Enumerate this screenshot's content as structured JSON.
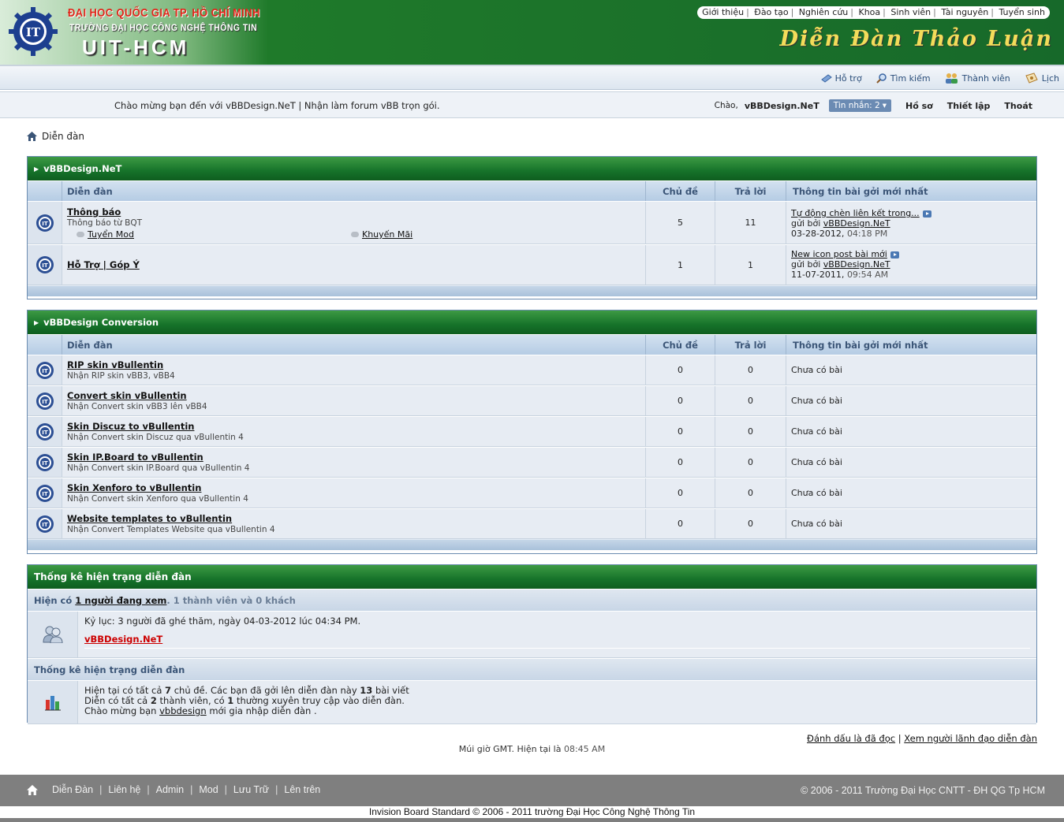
{
  "header": {
    "line1": "ĐẠI HỌC QUỐC GIA TP. HỒ CHÍ MINH",
    "line2": "TRƯỜNG ĐẠI HỌC CÔNG NGHỆ THÔNG TIN",
    "line3": "UIT-HCM",
    "logo_text": "IT",
    "site_title": "Diễn Đàn Thảo Luận",
    "topnav": [
      "Giới thiệu",
      "Đào tạo",
      "Nghiên cứu",
      "Khoa",
      "Sinh viên",
      "Tài nguyên",
      "Tuyển sinh"
    ]
  },
  "navbar": {
    "items": [
      {
        "label": "Hỗ trợ",
        "icon": "help-icon"
      },
      {
        "label": "Tìm kiếm",
        "icon": "search-icon"
      },
      {
        "label": "Thành viên",
        "icon": "members-icon"
      },
      {
        "label": "Lịch",
        "icon": "calendar-icon"
      }
    ]
  },
  "welcome": {
    "message": "Chào mừng bạn đến với vBBDesign.NeT | Nhận làm forum vBB trọn gói.",
    "hello": "Chào,",
    "username": "vBBDesign.NeT",
    "pm_label": "Tin nhắn: 2",
    "links": [
      "Hồ sơ",
      "Thiết lập",
      "Thoát"
    ]
  },
  "breadcrumb": {
    "label": "Diễn đàn"
  },
  "columns": {
    "forum": "Diễn đàn",
    "threads": "Chủ đề",
    "posts": "Trả lời",
    "last": "Thông tin bài gởi mới nhất"
  },
  "categories": [
    {
      "title": "vBBDesign.NeT",
      "forums": [
        {
          "title": "Thông báo",
          "desc": "Thông báo từ BQT",
          "subforums": [
            "Tuyển Mod",
            "Khuyến Mãi"
          ],
          "threads": "5",
          "posts": "11",
          "last_title": "Tự động chèn liên kết trong...",
          "last_by_prefix": "gửi bởi",
          "last_by": "vBBDesign.NeT",
          "last_date": "03-28-2012,",
          "last_time": "04:18 PM"
        },
        {
          "title": "Hỗ Trợ | Góp Ý",
          "desc": "",
          "threads": "1",
          "posts": "1",
          "last_title": "New icon post bài mới",
          "last_by_prefix": "gửi bởi",
          "last_by": "vBBDesign.NeT",
          "last_date": "11-07-2011,",
          "last_time": "09:54 AM"
        }
      ]
    },
    {
      "title": "vBBDesign Conversion",
      "forums": [
        {
          "title": "RIP skin vBullentin",
          "desc": "Nhận RIP skin vBB3, vBB4",
          "threads": "0",
          "posts": "0",
          "last_empty": "Chưa có bài"
        },
        {
          "title": "Convert skin vBullentin",
          "desc": "Nhận Convert skin vBB3 lên vBB4",
          "threads": "0",
          "posts": "0",
          "last_empty": "Chưa có bài"
        },
        {
          "title": "Skin Discuz to vBullentin",
          "desc": "Nhận Convert skin Discuz qua vBullentin 4",
          "threads": "0",
          "posts": "0",
          "last_empty": "Chưa có bài"
        },
        {
          "title": "Skin IP.Board to vBullentin",
          "desc": "Nhận Convert skin IP.Board qua vBullentin 4",
          "threads": "0",
          "posts": "0",
          "last_empty": "Chưa có bài"
        },
        {
          "title": "Skin Xenforo to vBullentin",
          "desc": "Nhận Convert skin Xenforo qua vBullentin 4",
          "threads": "0",
          "posts": "0",
          "last_empty": "Chưa có bài"
        },
        {
          "title": "Website templates to vBullentin",
          "desc": "Nhận Convert Templates Website qua vBullentin 4",
          "threads": "0",
          "posts": "0",
          "last_empty": "Chưa có bài"
        }
      ]
    }
  ],
  "stats": {
    "title": "Thống kê hiện trạng diễn đàn",
    "online_prefix": "Hiện có",
    "online_link": "1 người đang xem",
    "online_suffix": ". 1 thành viên và 0 khách",
    "record": "Kỷ lục: 3 người đã ghé thăm, ngày 04-03-2012 lúc 04:34 PM.",
    "online_user": "vBBDesign.NeT",
    "sub_title": "Thống kê hiện trạng diễn đàn",
    "line1_a": "Hiện tại có tất cả",
    "line1_b": "7",
    "line1_c": "chủ đề. Các bạn đã gởi lên diễn đàn này",
    "line1_d": "13",
    "line1_e": "bài viết",
    "line2_a": "Diễn có tất cả",
    "line2_b": "2",
    "line2_c": "thành viên, có",
    "line2_d": "1",
    "line2_e": "thường xuyên truy cập vào diễn đàn.",
    "line3_a": "Chào mừng bạn",
    "line3_b": "vbbdesign",
    "line3_c": "mới gia nhập diễn đàn ."
  },
  "bottom": {
    "mark_read": "Đánh dấu là đã đọc",
    "leaders": "Xem người lãnh đạo diễn đàn",
    "tz_prefix": "Múi giờ GMT. Hiện tại là",
    "tz_time": "08:45 AM"
  },
  "footer": {
    "links": [
      "Diễn Đàn",
      "Liên hệ",
      "Admin",
      "Mod",
      "Lưu Trữ",
      "Lên trên"
    ],
    "right": "© 2006 - 2011 Trường Đại Học CNTT - ĐH QG Tp HCM",
    "copyright": "Invision Board Standard © 2006 - 2011 trường Đại Học Công Nghệ Thông Tin"
  },
  "colors": {
    "header_green": "#17692a",
    "link_red": "#cc0000",
    "nav_blue": "#2b4e7a"
  }
}
